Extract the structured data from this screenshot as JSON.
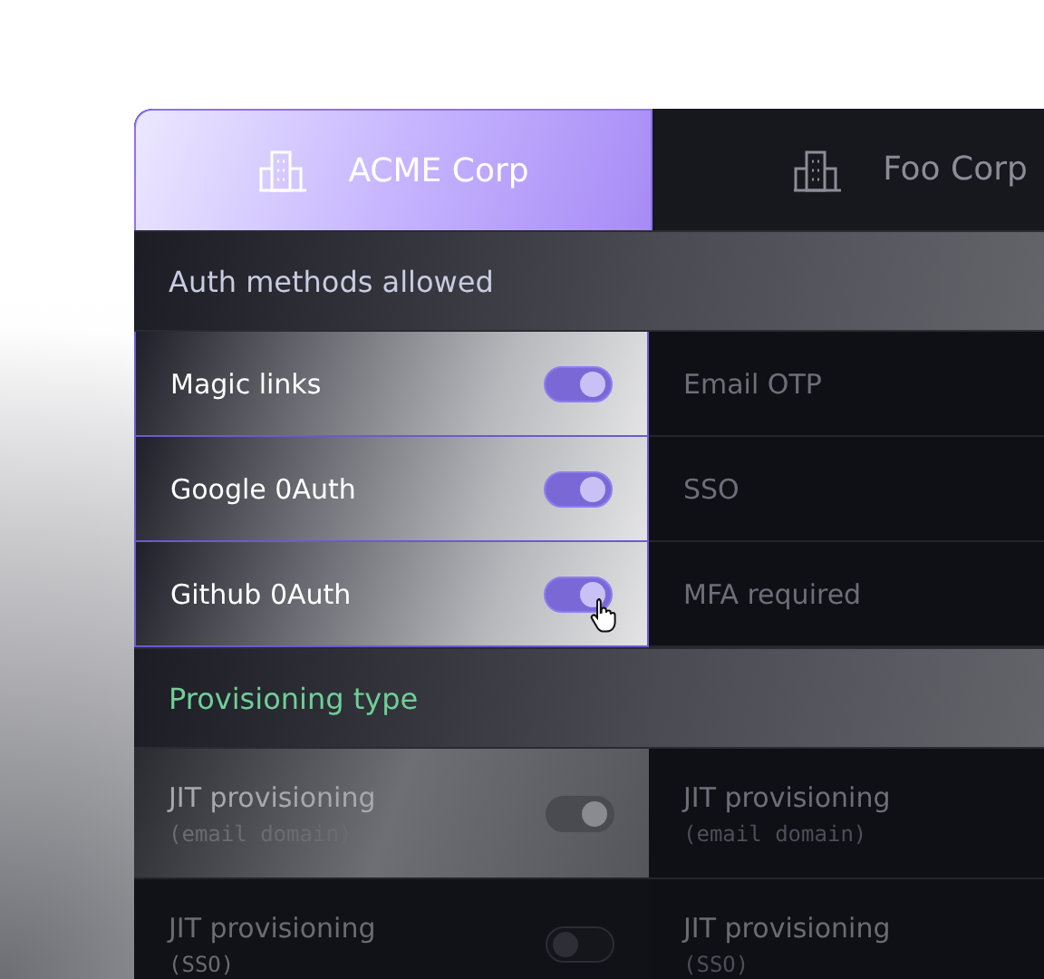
{
  "tabs": [
    {
      "label": "ACME Corp",
      "selected": true
    },
    {
      "label": "Foo Corp",
      "selected": false
    }
  ],
  "sections": [
    {
      "title": "Auth methods allowed",
      "color": "#c9cbe0",
      "rows": [
        {
          "left": {
            "label": "Magic links",
            "on": true,
            "disabled": false
          },
          "right": {
            "label": "Email OTP"
          }
        },
        {
          "left": {
            "label": "Google 0Auth",
            "on": true,
            "disabled": false
          },
          "right": {
            "label": "SSO"
          }
        },
        {
          "left": {
            "label": "Github 0Auth",
            "on": true,
            "disabled": false
          },
          "right": {
            "label": "MFA required"
          }
        }
      ]
    },
    {
      "title": "Provisioning type",
      "color": "#6fcf97",
      "rows": [
        {
          "left": {
            "label": "JIT provisioning",
            "note": "(email domain)",
            "on": true,
            "disabled": true
          },
          "right": {
            "label": "JIT provisioning",
            "note": "(email domain)"
          }
        },
        {
          "left": {
            "label": "JIT provisioning",
            "note": "(SSO)",
            "on": false,
            "disabled": true
          },
          "right": {
            "label": "JIT provisioning",
            "note": "(SSO)"
          }
        }
      ]
    }
  ]
}
